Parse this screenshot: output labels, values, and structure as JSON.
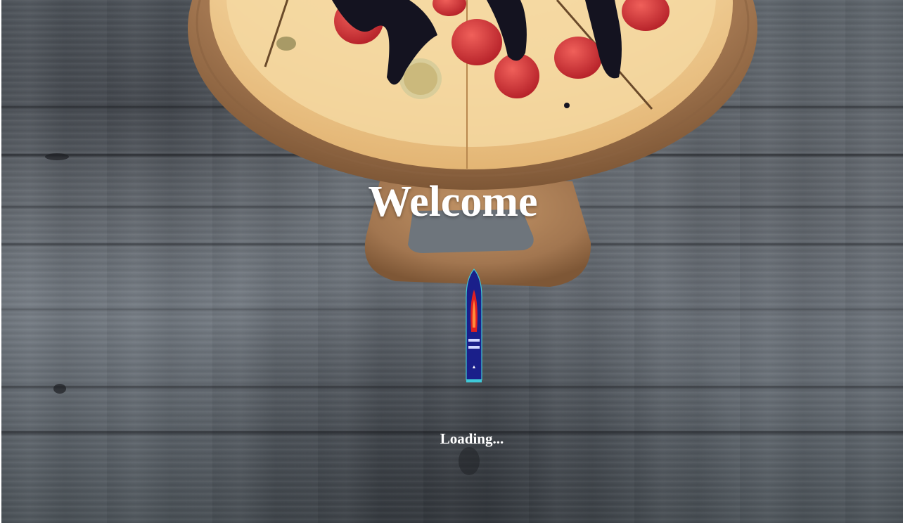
{
  "splash": {
    "title": "Welcome",
    "status_text": "Loading..."
  },
  "icons": {
    "loader": "rocket-loader-icon"
  },
  "colors": {
    "title_text": "#ffffff",
    "status_text": "#ffffff",
    "table_wood": "#737a82",
    "board_wood": "#a27650",
    "pizza_crust": "#f1cf97",
    "strawberry": "#d9353a",
    "chocolate": "#141320",
    "loader_body": "#1a1f8a",
    "loader_flame": "#e02020"
  }
}
